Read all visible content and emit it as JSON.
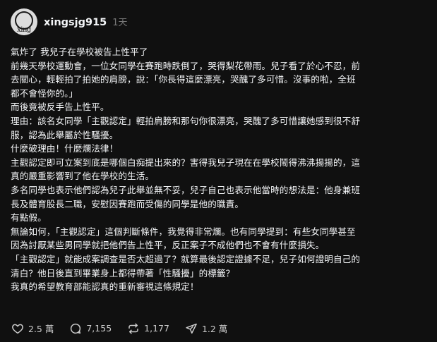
{
  "author": {
    "avatar_text": "xing",
    "username": "xingsjg915",
    "time": "1天"
  },
  "post_lines": [
    "氣炸了 我兒子在學校被告上性平了",
    "前幾天學校運動會，一位女同學在賽跑時跌倒了，哭得梨花帶雨。兒子看了於心不忍，前",
    "去關心，輕輕拍了拍她的肩膀，說：「你長得這麼漂亮，哭醜了多可惜。沒事的啦，全班",
    "都不會怪你的。」",
    "而後竟被反手告上性平。",
    "理由：該名女同學「主觀認定」輕拍肩膀和那句你很漂亮，哭醜了多可惜讓她感到很不舒",
    "服，認為此舉屬於性騷擾。",
    "什麼破理由！什麼爛法律！",
    "主觀認定即可立案到底是哪個白痴提出來的？害得我兒子現在在學校鬧得沸沸揚揚的，這",
    "真的嚴重影響到了他在學校的生活。",
    "多名同學也表示他們認為兒子此舉並無不妥，兒子自己也表示他當時的想法是：他身兼班",
    "長及體育股長二職，安慰因賽跑而受傷的同學是他的職責。",
    "有點假。",
    "無論如何，「主觀認定」這個判斷條件，我覺得非常爛。也有同學提到：有些女同學甚至",
    "因為討厭某些男同學就把他們告上性平，反正案子不成他們也不會有什麼損失。",
    "「主觀認定」就能成案調查是否太超過了？就算最後認定證據不足，兒子如何證明自己的",
    "清白？他日後直到畢業身上都得帶著「性騷擾」的標籤？",
    "我真的希望教育部能認真的重新審視這條規定！"
  ],
  "actions": {
    "likes": "2.5 萬",
    "comments": "7,155",
    "reposts": "1,177",
    "shares": "1.2 萬"
  },
  "colors": {
    "background": "#101010",
    "text": "#f3f5f7",
    "muted": "#777777",
    "icon": "#cccccc"
  },
  "icons": {
    "like": "heart-icon",
    "comment": "comment-icon",
    "repost": "repost-icon",
    "share": "share-icon"
  }
}
